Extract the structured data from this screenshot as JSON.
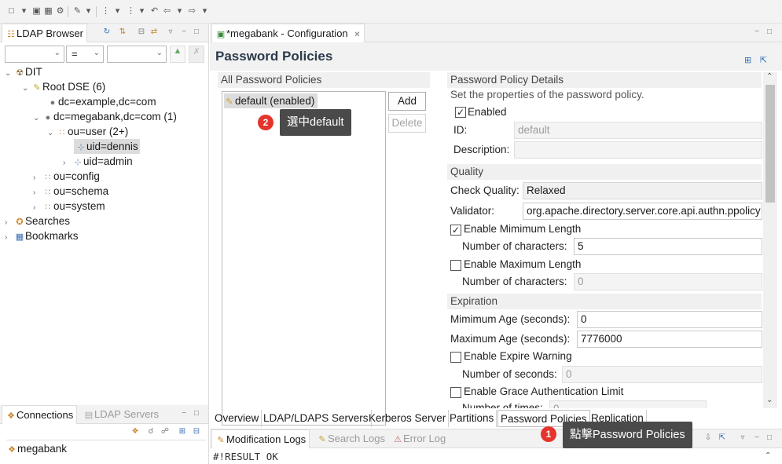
{
  "ldap_browser": {
    "tab_label": "LDAP Browser",
    "filter_operator": "=",
    "tree": [
      {
        "label": "DIT"
      },
      {
        "label": "Root DSE (6)"
      },
      {
        "label": "dc=example,dc=com"
      },
      {
        "label": "dc=megabank,dc=com (1)"
      },
      {
        "label": "ou=user (2+)"
      },
      {
        "label": "uid=dennis"
      },
      {
        "label": "uid=admin"
      },
      {
        "label": "ou=config"
      },
      {
        "label": "ou=schema"
      },
      {
        "label": "ou=system"
      },
      {
        "label": "Searches"
      },
      {
        "label": "Bookmarks"
      }
    ]
  },
  "connections": {
    "tab_label": "Connections",
    "servers_tab_label": "LDAP Servers",
    "items": [
      {
        "label": "megabank"
      }
    ]
  },
  "editor": {
    "tab_label": "*megabank - Configuration",
    "page_title": "Password Policies",
    "list_section": {
      "title": "All Password Policies",
      "items": [
        {
          "label": "default (enabled)"
        }
      ],
      "add_label": "Add",
      "delete_label": "Delete"
    },
    "details": {
      "title": "Password Policy Details",
      "description": "Set the properties of the password policy.",
      "enabled_label": "Enabled",
      "enabled_checked": true,
      "id_label": "ID:",
      "id_value": "default",
      "description_label": "Description:",
      "description_value": ""
    },
    "quality": {
      "title": "Quality",
      "check_quality_label": "Check Quality:",
      "check_quality_value": "Relaxed",
      "validator_label": "Validator:",
      "validator_value": "org.apache.directory.server.core.api.authn.ppolicy",
      "enable_min_length_label": "Enable Mimimum Length",
      "enable_min_length_checked": true,
      "min_chars_label": "Number of characters:",
      "min_chars_value": "5",
      "enable_max_length_label": "Enable Maximum Length",
      "enable_max_length_checked": false,
      "max_chars_label": "Number of characters:",
      "max_chars_value": "0"
    },
    "expiration": {
      "title": "Expiration",
      "min_age_label": "Mimimum Age (seconds):",
      "min_age_value": "0",
      "max_age_label": "Maximum Age (seconds):",
      "max_age_value": "7776000",
      "expire_warning_label": "Enable Expire Warning",
      "expire_warning_checked": false,
      "seconds_label": "Number of seconds:",
      "seconds_value": "0",
      "grace_label": "Enable Grace Authentication Limit",
      "grace_checked": false,
      "times_label": "Number of times:",
      "times_value": "0"
    },
    "bottom_tabs": [
      {
        "label": "Overview"
      },
      {
        "label": "LDAP/LDAPS Servers"
      },
      {
        "label": "Kerberos Server"
      },
      {
        "label": "Partitions"
      },
      {
        "label": "Password Policies"
      },
      {
        "label": "Replication"
      }
    ],
    "active_bottom_tab": "Password Policies"
  },
  "console": {
    "tabs": [
      {
        "label": "Modification Logs"
      },
      {
        "label": "Search Logs"
      },
      {
        "label": "Error Log"
      }
    ],
    "content": "#!RESULT OK"
  },
  "annotations": [
    {
      "number": "1",
      "text": "點擊Password Policies"
    },
    {
      "number": "2",
      "text": "選中default"
    }
  ],
  "colors": {
    "callout_bg": "#4a4a4a",
    "badge_red": "#e5342b",
    "selection": "#dcdcdc"
  }
}
